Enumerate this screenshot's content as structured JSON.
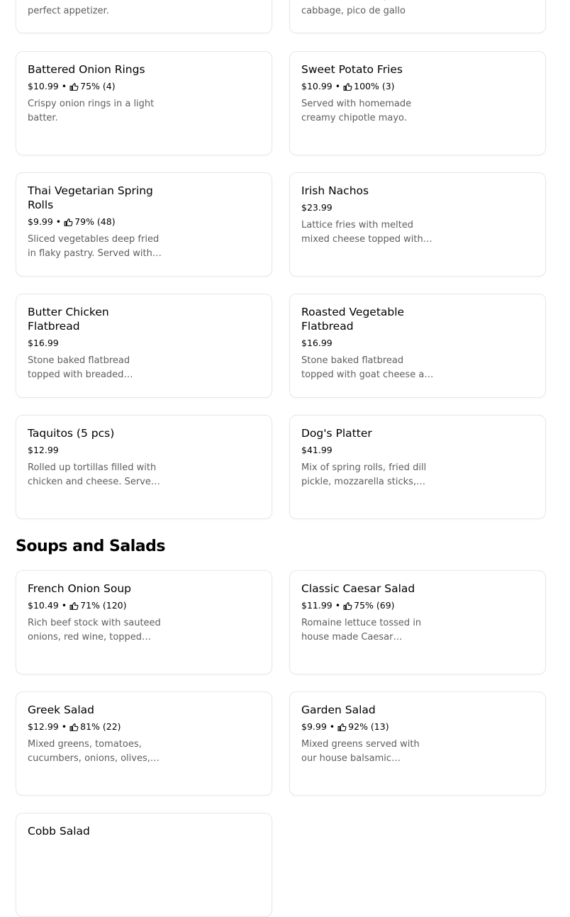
{
  "top_partial": {
    "left_desc": "perfect appetizer.",
    "right_desc": "Beef battered fish, shredded cabbage, pico de gallo"
  },
  "appetizers": [
    {
      "name": "Battered Onion Rings",
      "price": "$10.99",
      "rating": "75% (4)",
      "desc": "Crispy onion rings in a light batter."
    },
    {
      "name": "Sweet Potato Fries",
      "price": "$10.99",
      "rating": "100% (3)",
      "desc": "Served with homemade creamy chipotle mayo."
    },
    {
      "name": "Thai Vegetarian Spring Rolls",
      "price": "$9.99",
      "rating": "79% (48)",
      "desc": "Sliced vegetables deep fried in flaky pastry. Served with sweet chili sauce."
    },
    {
      "name": "Irish Nachos",
      "price": "$23.99",
      "rating": "",
      "desc": "Lattice fries with melted mixed cheese topped with bacon, green onions."
    },
    {
      "name": "Butter Chicken Flatbread",
      "price": "$16.99",
      "rating": "",
      "desc": "Stone baked flatbread topped with breaded chicken."
    },
    {
      "name": "Roasted Vegetable Flatbread",
      "price": "$16.99",
      "rating": "",
      "desc": "Stone baked flatbread topped with goat cheese and vegetables."
    },
    {
      "name": "Taquitos (5 pcs)",
      "price": "$12.99",
      "rating": "",
      "desc": "Rolled up tortillas filled with chicken and cheese. Served with salsa."
    },
    {
      "name": "Dog's Platter",
      "price": "$41.99",
      "rating": "",
      "desc": "Mix of spring rolls, fried dill pickle, mozzarella sticks, wings."
    }
  ],
  "section_title": "Soups and Salads",
  "soups_salads": [
    {
      "name": "French Onion Soup",
      "price": "$10.49",
      "rating": "71% (120)",
      "desc": "Rich beef stock with sauteed onions, red wine, topped with cheese."
    },
    {
      "name": "Classic Caesar Salad",
      "price": "$11.99",
      "rating": "75% (69)",
      "desc": "Romaine lettuce tossed in house made Caesar dressing."
    },
    {
      "name": "Greek Salad",
      "price": "$12.99",
      "rating": "81% (22)",
      "desc": "Mixed greens, tomatoes, cucumbers, onions, olives, feta."
    },
    {
      "name": "Garden Salad",
      "price": "$9.99",
      "rating": "92% (13)",
      "desc": "Mixed greens served with our house balsamic dressing."
    },
    {
      "name": "Cobb Salad",
      "price": "",
      "rating": "",
      "desc": ""
    }
  ],
  "icons": {
    "rating": "thumbs-up-icon"
  },
  "colors": {
    "text": "#000000",
    "muted": "#5e5e5e",
    "border": "#e8e8e8"
  }
}
